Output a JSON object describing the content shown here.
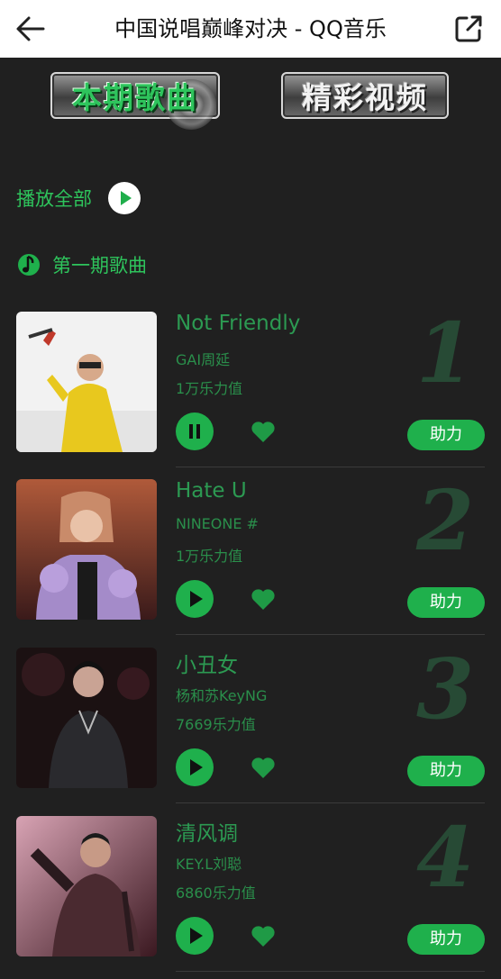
{
  "header": {
    "title": "中国说唱巅峰对决 - QQ音乐"
  },
  "tabs": [
    {
      "label": "本期歌曲",
      "active": true
    },
    {
      "label": "精彩视频",
      "active": false
    }
  ],
  "play_all": {
    "label": "播放全部"
  },
  "episode": {
    "label": "第一期歌曲"
  },
  "songs": [
    {
      "title": "Not Friendly",
      "artist": "GAI周延",
      "value": "1万乐力值",
      "rank": "1",
      "state": "playing",
      "boost_label": "助力"
    },
    {
      "title": "Hate U",
      "artist": "NINEONE #",
      "value": "1万乐力值",
      "rank": "2",
      "state": "paused",
      "boost_label": "助力"
    },
    {
      "title": "小丑女",
      "artist": "杨和苏KeyNG",
      "value": "7669乐力值",
      "rank": "3",
      "state": "paused",
      "boost_label": "助力"
    },
    {
      "title": "清风调",
      "artist": "KEY.L刘聪",
      "value": "6860乐力值",
      "rank": "4",
      "state": "paused",
      "boost_label": "助力"
    }
  ],
  "colors": {
    "accent": "#1fb04c",
    "background": "#202020",
    "rank": "#274a35"
  }
}
